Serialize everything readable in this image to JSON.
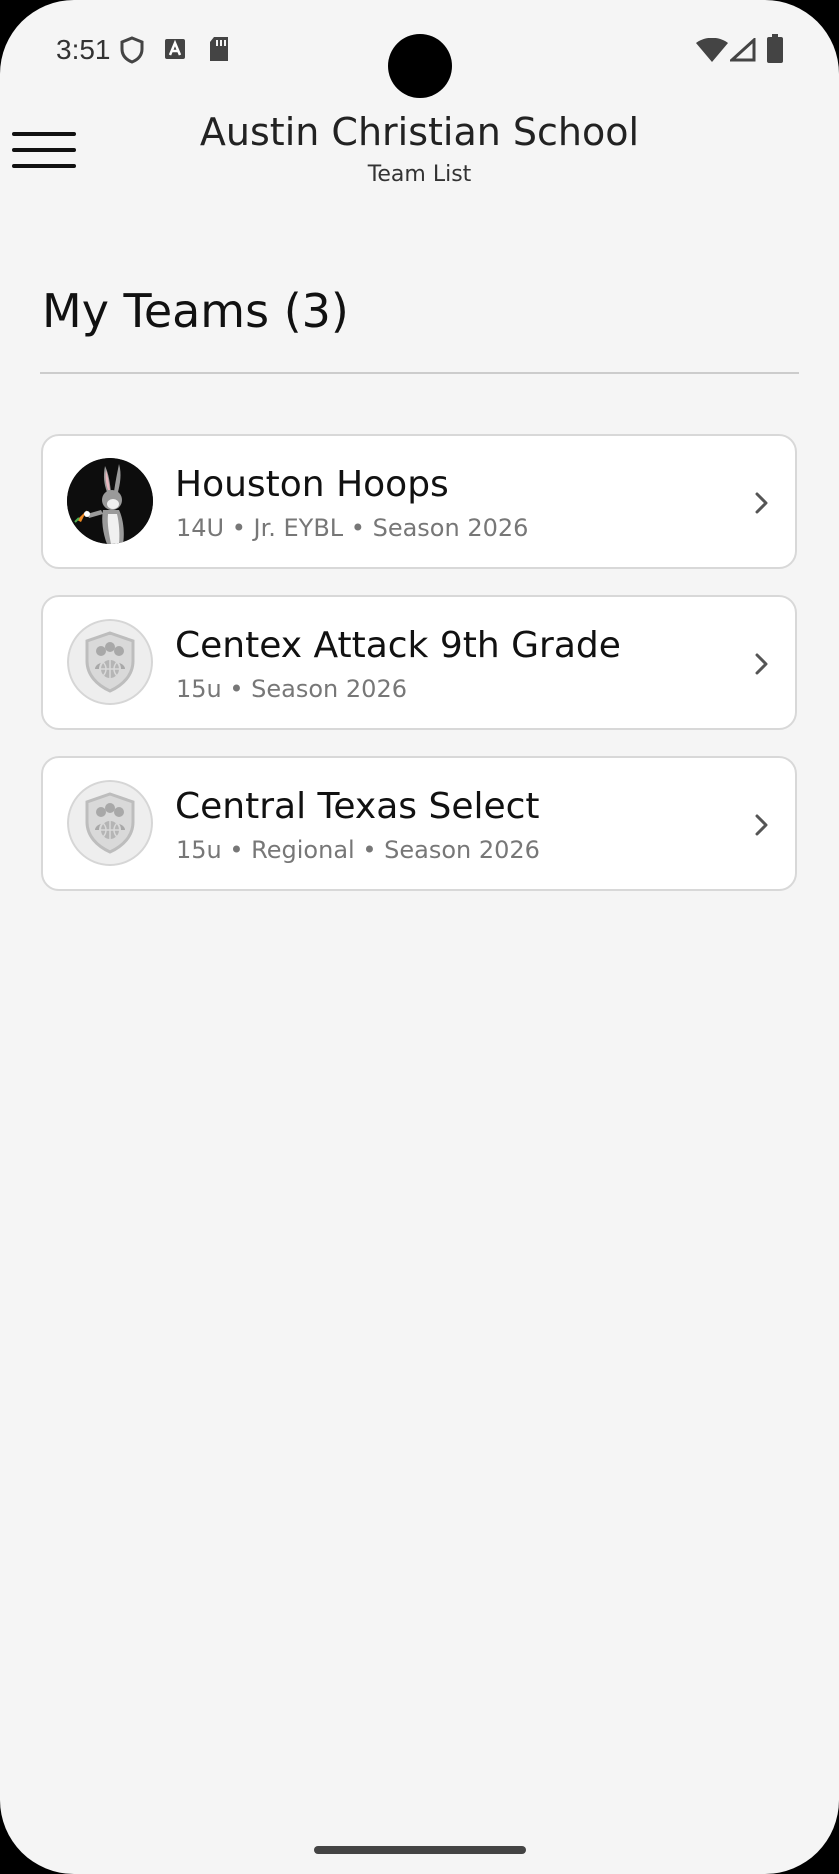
{
  "status_bar": {
    "time": "3:51",
    "left_icons": [
      "shield-icon",
      "font-a-icon",
      "sd-card-icon"
    ],
    "right_icons": [
      "wifi-icon",
      "cell-signal-icon",
      "battery-icon"
    ]
  },
  "header": {
    "title": "Austin Christian School",
    "subtitle": "Team List",
    "menu_icon": "hamburger-menu-icon"
  },
  "section": {
    "title": "My Teams (3)"
  },
  "teams": [
    {
      "name": "Houston Hoops",
      "meta": "14U • Jr. EYBL • Season 2026",
      "avatar": "bunny-logo-icon"
    },
    {
      "name": "Centex Attack 9th Grade",
      "meta": "15u • Season 2026",
      "avatar": "team-shield-placeholder-icon"
    },
    {
      "name": "Central Texas Select",
      "meta": "15u • Regional • Season 2026",
      "avatar": "team-shield-placeholder-icon"
    }
  ],
  "colors": {
    "background": "#f5f5f5",
    "card": "#ffffff",
    "card_border": "#d8d8d8",
    "text_primary": "#111111",
    "text_secondary": "#777777"
  }
}
